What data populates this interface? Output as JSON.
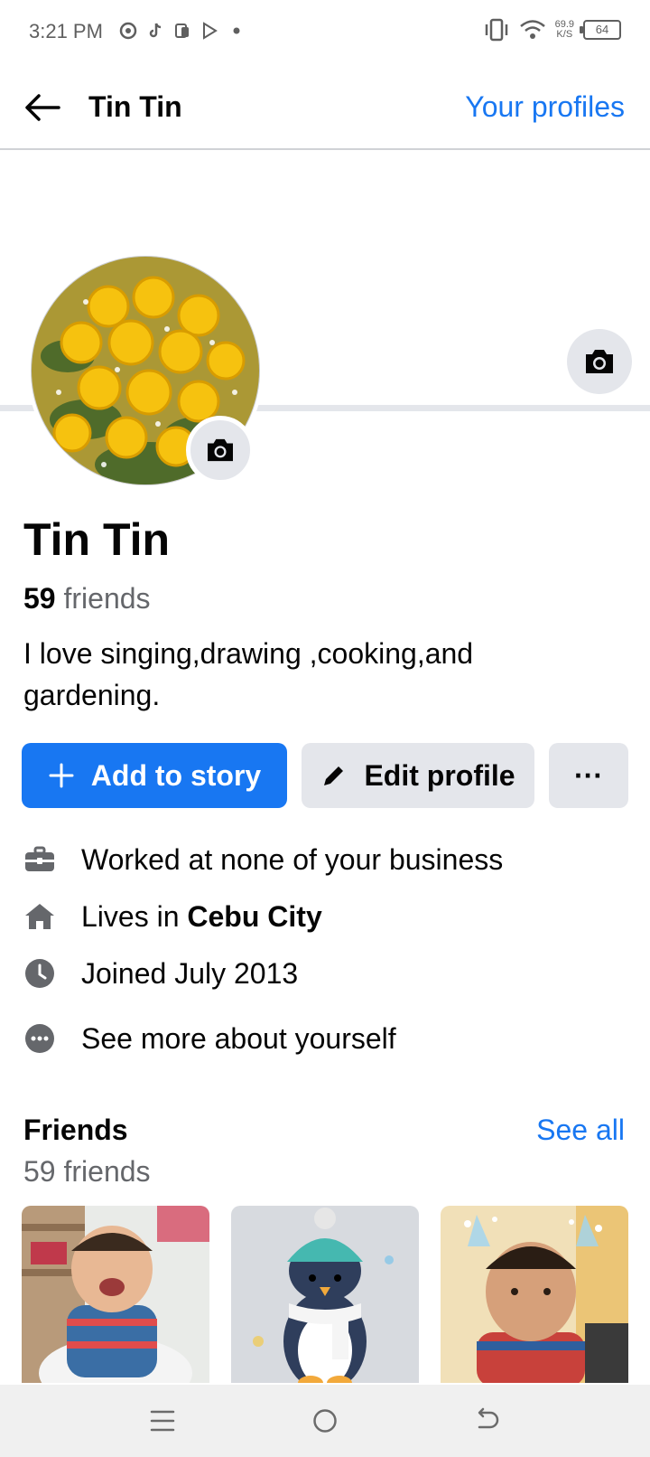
{
  "status_bar": {
    "time": "3:21 PM",
    "network_speed_value": "69.9",
    "network_speed_unit": "K/S",
    "battery": "64",
    "icons": [
      "chrome-icon",
      "tiktok-icon",
      "news-icon",
      "play-store-icon",
      "dot-icon",
      "vibrate-icon",
      "wifi-icon"
    ]
  },
  "header": {
    "title": "Tin Tin",
    "your_profiles": "Your profiles"
  },
  "profile": {
    "name": "Tin Tin",
    "friends_count": "59",
    "friends_word": "friends",
    "bio": "I love singing,drawing ,cooking,and gardening."
  },
  "actions": {
    "add_story": "Add to story",
    "edit_profile": "Edit profile",
    "more": "···"
  },
  "details": {
    "work": "Worked at none of your business",
    "lives_prefix": "Lives in ",
    "lives_city": "Cebu City",
    "joined": "Joined July 2013",
    "see_more": "See more about yourself"
  },
  "friends_section": {
    "heading": "Friends",
    "see_all": "See all",
    "count_text": "59 friends"
  },
  "colors": {
    "accent": "#1877f2",
    "button_gray": "#e4e6eb",
    "secondary_text": "#65676b"
  }
}
